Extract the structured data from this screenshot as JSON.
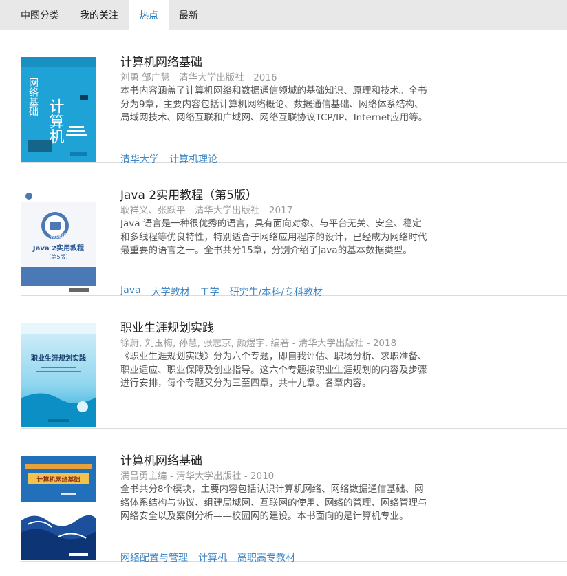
{
  "tabs": [
    {
      "label": "中图分类"
    },
    {
      "label": "我的关注"
    },
    {
      "label": "热点"
    },
    {
      "label": "最新"
    }
  ],
  "active_tab": "热点",
  "books": [
    {
      "title": "计算机网络基础",
      "meta": "刘勇 邹广慧 - 清华大学出版社 - 2016",
      "description": "本书内容涵盖了计算机网络和数据通信领域的基础知识、原理和技术。全书分为9章，主要内容包括计算机网络概论、数据通信基础、网络体系结构、局域网技术、网络互联和广域网、网络互联协议TCP/IP、Internet应用等。",
      "tags": [
        "清华大学",
        "计算机理论"
      ],
      "cover": {
        "text_main": "计算机",
        "text_side": "网络基础",
        "color": "#1fa3d6"
      }
    },
    {
      "title": "Java 2实用教程（第5版）",
      "meta": "耿祥义、张跃平 - 清华大学出版社 - 2017",
      "description": "Java 语言是一种很优秀的语言，具有面向对象、与平台无关、安全、稳定和多线程等优良特性，特别适合于网络应用程序的设计，已经成为网络时代最重要的语言之一。全书共分15章，分别介绍了Java的基本数据类型。",
      "tags": [
        "Java",
        "大学教材",
        "工学",
        "研究生/本科/专科教材"
      ],
      "cover": {
        "text_main": "Java 2实用教程",
        "text_sub": "（第5版）",
        "badge": "微课版",
        "color": "#4a79b5"
      }
    },
    {
      "title": "职业生涯规划实践",
      "meta": "徐蔚, 刘玉梅, 孙慧, 张志京, 颜煜宇, 编著 - 清华大学出版社 - 2018",
      "description": "《职业生涯规划实践》分为六个专题，即自我评估、职场分析、求职准备、职业适应、职业保障及创业指导。这六个专题按职业生涯规划的内容及步骤进行安排，每个专题又分为三至四章，共十九章。各章内容。",
      "tags": [],
      "cover": {
        "text_main": "职业生涯规划实践",
        "color": "#2fb6dc"
      }
    },
    {
      "title": "计算机网络基础",
      "meta": "满昌勇主编 - 清华大学出版社 - 2010",
      "description": "全书共分8个模块，主要内容包括认识计算机网络、网络数据通信基础、网络体系结构与协议、组建局域网、互联网的使用、网络的管理、网络管理与网络安全以及案例分析——校园网的建设。本书面向的是计算机专业。",
      "tags": [
        "网络配置与管理",
        "计算机",
        "高职高专教材"
      ],
      "cover": {
        "text_main": "计算机网络基础",
        "color": "#1e5fa8"
      }
    }
  ]
}
